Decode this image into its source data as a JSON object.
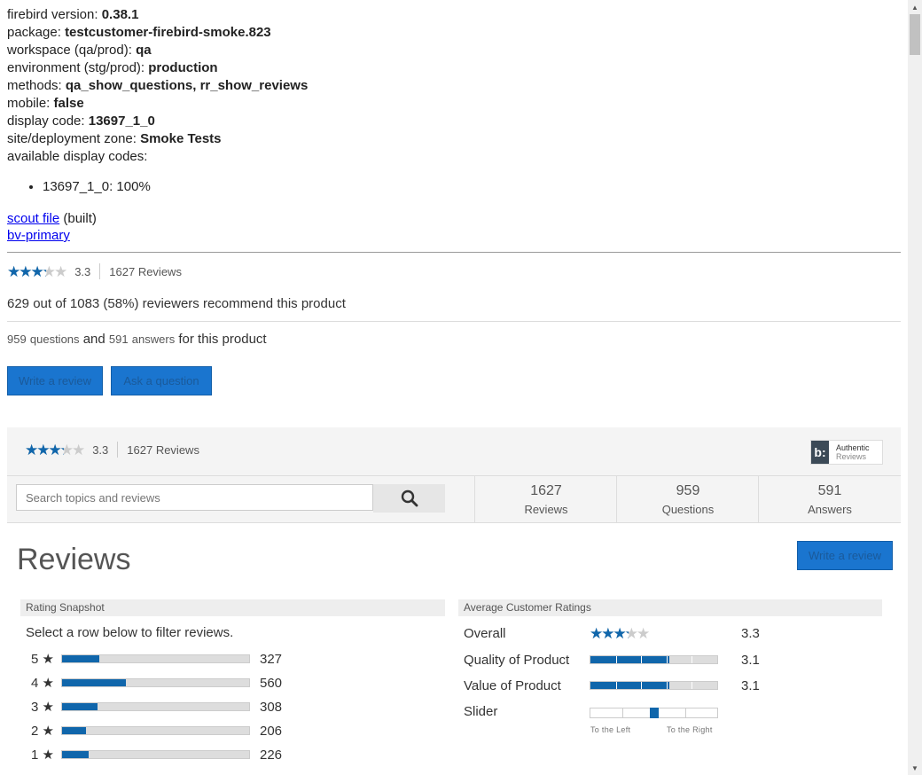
{
  "info": {
    "firebird_version_label": "firebird version:",
    "firebird_version": "0.38.1",
    "package_label": "package:",
    "package": "testcustomer-firebird-smoke.823",
    "workspace_label": "workspace (qa/prod):",
    "workspace": "qa",
    "environment_label": "environment (stg/prod):",
    "environment": "production",
    "methods_label": "methods:",
    "methods": "qa_show_questions, rr_show_reviews",
    "mobile_label": "mobile:",
    "mobile": "false",
    "display_code_label": "display code:",
    "display_code": "13697_1_0",
    "zone_label": "site/deployment zone:",
    "zone": "Smoke Tests",
    "available_label": "available display codes:",
    "available_codes": [
      "13697_1_0: 100%"
    ]
  },
  "links": {
    "scout_file": "scout file",
    "built": "(built)",
    "bv_primary": "bv-primary"
  },
  "summary": {
    "rating": "3.3",
    "rating_fraction": 0.66,
    "reviews": "1627 Reviews",
    "recommend": "629 out of 1083 (58%) reviewers recommend this product",
    "questions_count": "959",
    "questions_word": "questions",
    "and": "and",
    "answers_count": "591",
    "answers_word": "answers",
    "for_product": "for this product"
  },
  "buttons": {
    "write_review": "Write a review",
    "ask_question": "Ask a question"
  },
  "panel": {
    "rating": "3.3",
    "reviews": "1627 Reviews",
    "badge_logo": "b:",
    "badge_title": "Authentic",
    "badge_sub": "Reviews"
  },
  "search": {
    "placeholder": "Search topics and reviews"
  },
  "stats": [
    {
      "value": "1627",
      "label": "Reviews"
    },
    {
      "value": "959",
      "label": "Questions"
    },
    {
      "value": "591",
      "label": "Answers"
    }
  ],
  "reviews_section": {
    "heading": "Reviews",
    "write_review": "Write a review",
    "snapshot_title": "Rating Snapshot",
    "filter_hint": "Select a row below to filter reviews.",
    "histogram": [
      {
        "stars": "5",
        "count": "327",
        "fraction": 0.2
      },
      {
        "stars": "4",
        "count": "560",
        "fraction": 0.34
      },
      {
        "stars": "3",
        "count": "308",
        "fraction": 0.19
      },
      {
        "stars": "2",
        "count": "206",
        "fraction": 0.13
      },
      {
        "stars": "1",
        "count": "226",
        "fraction": 0.14
      }
    ],
    "avg_title": "Average Customer Ratings",
    "overall_label": "Overall",
    "overall_value": "3.3",
    "overall_fraction": 0.66,
    "quality_label": "Quality of Product",
    "quality_value": "3.1",
    "quality_fraction": 0.62,
    "value_label": "Value of Product",
    "value_value": "3.1",
    "value_fraction": 0.62,
    "slider_label": "Slider",
    "slider_position": 0.5,
    "slider_left": "To the Left",
    "slider_right": "To the Right"
  },
  "colors": {
    "accent": "#1066ab",
    "button": "#1a75cf"
  }
}
